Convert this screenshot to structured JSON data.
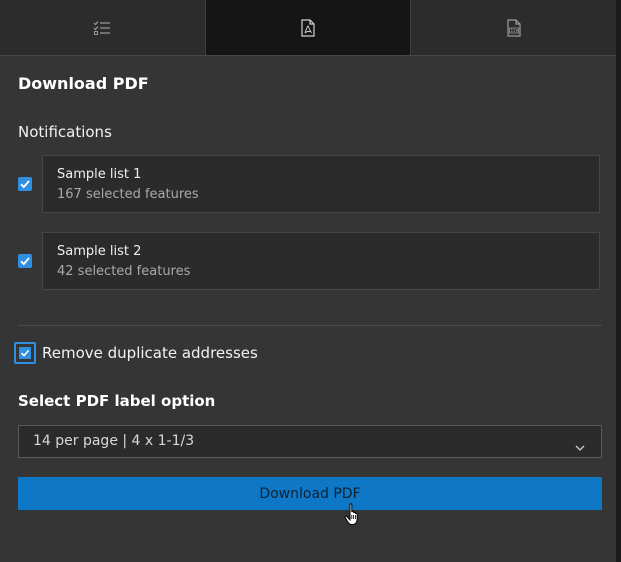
{
  "tabs": [
    {
      "icon": "checklist-icon",
      "active": false
    },
    {
      "icon": "pdf-file-icon",
      "active": true
    },
    {
      "icon": "csv-file-icon",
      "active": false
    }
  ],
  "panel": {
    "title": "Download PDF",
    "notifications_label": "Notifications",
    "lists": [
      {
        "name": "Sample list 1",
        "count": "167 selected features",
        "checked": true
      },
      {
        "name": "Sample list 2",
        "count": "42 selected features",
        "checked": true
      }
    ],
    "remove_duplicates": {
      "label": "Remove duplicate addresses",
      "checked": true
    },
    "label_option": {
      "title": "Select PDF label option",
      "selected": "14 per page | 4 x 1-1/3"
    },
    "download_button": "Download PDF"
  },
  "colors": {
    "accent": "#2f8fe0",
    "button": "#0e78c7",
    "panel_bg": "#353535",
    "active_tab": "#151515"
  }
}
